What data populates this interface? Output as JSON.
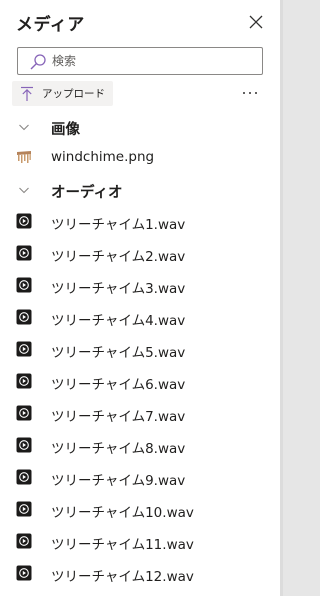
{
  "pane": {
    "title": "メディア",
    "close_icon": "close-icon"
  },
  "search": {
    "value": "",
    "placeholder": "検索"
  },
  "toolbar": {
    "upload_label": "アップロード",
    "more_icon": "more-horizontal-icon"
  },
  "sections": {
    "images": {
      "label": "画像",
      "items": [
        "windchime.png"
      ]
    },
    "audio": {
      "label": "オーディオ",
      "items": [
        "ツリーチャイム1.wav",
        "ツリーチャイム2.wav",
        "ツリーチャイム3.wav",
        "ツリーチャイム4.wav",
        "ツリーチャイム5.wav",
        "ツリーチャイム6.wav",
        "ツリーチャイム7.wav",
        "ツリーチャイム8.wav",
        "ツリーチャイム9.wav",
        "ツリーチャイム10.wav",
        "ツリーチャイム11.wav",
        "ツリーチャイム12.wav"
      ]
    }
  },
  "colors": {
    "upload_accent": "#8764b8",
    "search_accent": "#8764b8",
    "audio_icon_bg": "#1b1a19"
  }
}
